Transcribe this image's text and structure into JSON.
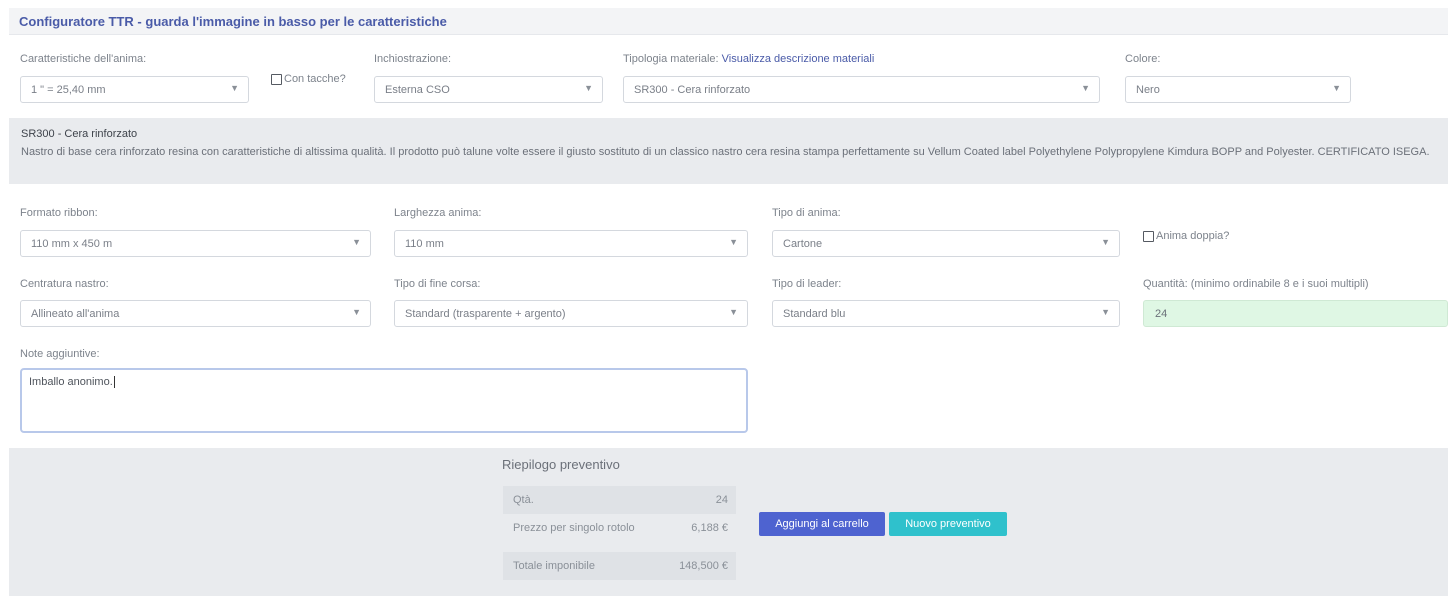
{
  "header": {
    "title": "Configuratore TTR - guarda l'immagine in basso per le caratteristiche"
  },
  "row1": {
    "anima": {
      "label": "Caratteristiche dell'anima:",
      "value": "1 \" = 25,40 mm"
    },
    "tacche": {
      "label": "Con tacche?"
    },
    "inchiostrazione": {
      "label": "Inchiostrazione:",
      "value": "Esterna CSO"
    },
    "materiale": {
      "label": "Tipologia materiale:",
      "link": "Visualizza descrizione materiali",
      "value": "SR300 - Cera rinforzato"
    },
    "colore": {
      "label": "Colore:",
      "value": "Nero"
    }
  },
  "description": {
    "title": "SR300 - Cera rinforzato",
    "text": "Nastro di base cera rinforzato resina con caratteristiche di altissima qualità. Il prodotto può talune volte essere il giusto sostituto di un classico nastro cera resina stampa perfettamente su Vellum Coated label Polyethylene Polypropylene Kimdura BOPP and Polyester. CERTIFICATO ISEGA."
  },
  "row2": {
    "formato": {
      "label": "Formato ribbon:",
      "value": "110 mm x 450 m"
    },
    "larghezza": {
      "label": "Larghezza anima:",
      "value": "110 mm"
    },
    "tipo_anima": {
      "label": "Tipo di anima:",
      "value": "Cartone"
    },
    "doppia": {
      "label": "Anima doppia?"
    }
  },
  "row3": {
    "centratura": {
      "label": "Centratura nastro:",
      "value": "Allineato all'anima"
    },
    "fine_corsa": {
      "label": "Tipo di fine corsa:",
      "value": "Standard (trasparente + argento)"
    },
    "leader": {
      "label": "Tipo di leader:",
      "value": "Standard blu"
    },
    "quantita": {
      "label": "Quantità: (minimo ordinabile 8 e i suoi multipli)",
      "value": "24"
    }
  },
  "notes": {
    "label": "Note aggiuntive:",
    "value": "Imballo anonimo."
  },
  "summary": {
    "title": "Riepilogo preventivo",
    "rows": [
      {
        "key": "Qtà.",
        "value": "24"
      },
      {
        "key": "Prezzo per singolo rotolo",
        "value": "6,188 €"
      },
      {
        "key": "Totale imponibile",
        "value": "148,500 €"
      }
    ],
    "add_cart_label": "Aggiungi al carrello",
    "new_quote_label": "Nuovo preventivo"
  },
  "icons": {
    "dropdown": "chevron-down-icon",
    "checkbox": "checkbox-icon"
  },
  "colors": {
    "accent": "#4a5ba8",
    "cart_button": "#4e63d0",
    "quote_button": "#2fc1cc",
    "quantity_bg": "#dff7e4"
  }
}
